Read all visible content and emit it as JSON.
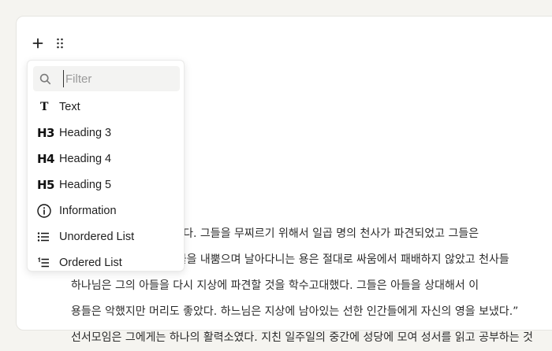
{
  "block_controls": {
    "add_icon": "plus-icon",
    "drag_icon": "drag-handle-icon"
  },
  "menu": {
    "filter_placeholder": "Filter",
    "filter_value": "",
    "items": [
      {
        "icon": "T",
        "icon_name": "text-icon",
        "label": "Text"
      },
      {
        "icon": "H3",
        "icon_name": "heading-3-icon",
        "label": "Heading 3"
      },
      {
        "icon": "H4",
        "icon_name": "heading-4-icon",
        "label": "Heading 4"
      },
      {
        "icon": "H5",
        "icon_name": "heading-5-icon",
        "label": "Heading 5"
      },
      {
        "icon": "",
        "icon_name": "info-icon",
        "label": "Information"
      },
      {
        "icon": "",
        "icon_name": "unordered-list-icon",
        "label": "Unordered List"
      },
      {
        "icon": "",
        "icon_name": "ordered-list-icon",
        "label": "Ordered List"
      }
    ]
  },
  "content": {
    "lines": [
      "일곱 마리의 용이 일어났다. 그들을 무찌르기 위해서 일곱 명의 천사가 파견되었고 그들은",
      "일곱 개의 뿔을 가지고 불을 내뿜으며 날아다니는 용은 절대로 싸움에서 패배하지 않았고 천사들",
      "하나님은 그의 아들을 다시 지상에 파견할 것을 학수고대했다. 그들은 아들을 상대해서 이",
      "용들은 악했지만 머리도 좋았다. 하느님은 지상에 남아있는 선한 인간들에게 자신의 영을 보냈다.”",
      "선서모임은 그에게는 하나의 활력소였다. 지친 일주일의 중간에 성당에 모여 성서를 읽고 공부하는 것"
    ]
  },
  "colors": {
    "page_bg": "#f5f4f0",
    "canvas_bg": "#ffffff",
    "menu_bg": "#ffffff",
    "filter_bg": "#f3f3f2"
  }
}
